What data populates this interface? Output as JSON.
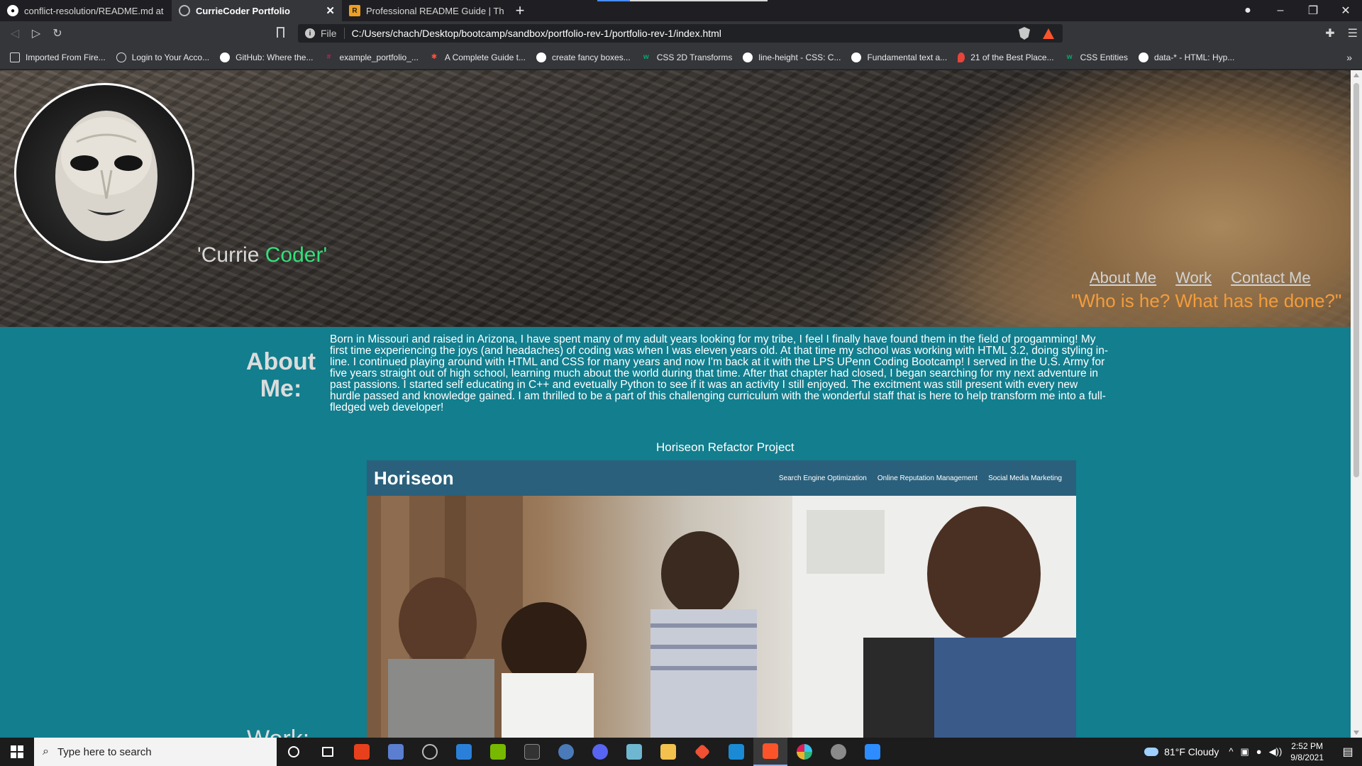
{
  "browser": {
    "tabs": [
      {
        "title": "conflict-resolution/README.md at ma",
        "icon": "github-icon",
        "active": false
      },
      {
        "title": "CurrieCoder Portfolio",
        "icon": "globe-icon",
        "active": true
      },
      {
        "title": "Professional README Guide | The Full",
        "icon": "favicon-icon",
        "active": false
      }
    ],
    "url_scheme": "File",
    "url": "C:/Users/chach/Desktop/bootcamp/sandbox/portfolio-rev-1/portfolio-rev-1/index.html",
    "bookmarks": [
      {
        "label": "Imported From Fire...",
        "icon": "folder-icon"
      },
      {
        "label": "Login to Your Acco...",
        "icon": "globe-icon"
      },
      {
        "label": "GitHub: Where the...",
        "icon": "github-icon"
      },
      {
        "label": "example_portfolio_...",
        "icon": "slack-icon"
      },
      {
        "label": "A Complete Guide t...",
        "icon": "star-icon"
      },
      {
        "label": "create fancy boxes...",
        "icon": "cap-icon"
      },
      {
        "label": "CSS 2D Transforms",
        "icon": "w3-icon"
      },
      {
        "label": "line-height - CSS: C...",
        "icon": "cap-icon"
      },
      {
        "label": "Fundamental text a...",
        "icon": "cap-icon"
      },
      {
        "label": "21 of the Best Place...",
        "icon": "pin-icon"
      },
      {
        "label": "CSS Entities",
        "icon": "w3-icon"
      },
      {
        "label": "data-* - HTML: Hyp...",
        "icon": "cap-icon"
      }
    ]
  },
  "page": {
    "brand_first": "'Currie",
    "brand_second": "Coder'",
    "nav": [
      "About Me",
      "Work",
      "Contact Me"
    ],
    "tagline": "\"Who is he? What has he done?\"",
    "about_heading": "About Me:",
    "about_text": "Born in Missouri and raised in Arizona, I have spent many of my adult years looking for my tribe, I feel I finally have found them in the field of progamming! My first time experiencing the joys (and headaches) of coding was when I was eleven years old. At that time my school was working with HTML 3.2, doing styling in-line. I continued playing around with HTML and CSS for many years and now I'm back at it with the LPS UPenn Coding Bootcamp! I served in the U.S. Army for five years straight out of high school, learning much about the world during that time. After that chapter had closed, I began searching for my next adventure in past passions. I started self educating in C++ and evetually Python to see if it was an activity I still enjoyed. The excitment was still present with every new hurdle passed and knowledge gained. I am thrilled to be a part of this challenging curriculum with the wonderful staff that is here to help transform me into a full-fledged web developer!",
    "project_title": "Horiseon Refactor Project",
    "project": {
      "logo": "Horiseon",
      "nav": [
        "Search Engine Optimization",
        "Online Reputation Management",
        "Social Media Marketing"
      ]
    },
    "work_heading": "Work:"
  },
  "taskbar": {
    "search_placeholder": "Type here to search",
    "weather": "81°F  Cloudy",
    "time": "2:52 PM",
    "date": "9/8/2021"
  },
  "colors": {
    "page_bg": "#127e8e",
    "brand_accent": "#33e07a",
    "tagline": "#f39c3c",
    "project_header": "#2a607c"
  }
}
